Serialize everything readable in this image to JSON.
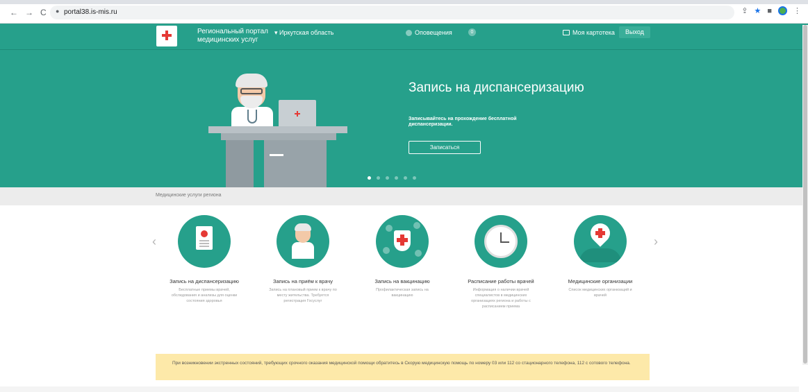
{
  "browser": {
    "nav_back": "←",
    "nav_forward": "→",
    "nav_reload": "C",
    "url": "portal38.is-mis.ru",
    "icons": [
      "share-icon",
      "star-icon",
      "extension-icon",
      "profile-icon",
      "menu-icon"
    ]
  },
  "header": {
    "site_title": "Региональный портал медицинских услуг",
    "region": "▾ Иркутская область",
    "notifications_label": "Оповещения",
    "notifications_count": "0",
    "cabinet_label": "Моя картотека",
    "logout_label": "Выход"
  },
  "hero": {
    "title": "Запись на диспансеризацию",
    "subtitle": "Записывайтесь на прохождение бесплатной диспансеризации.",
    "button_label": "Записаться",
    "slides_count": 6,
    "active_slide": 1
  },
  "breadcrumb": "Медицинские услуги региона",
  "services": [
    {
      "title": "Запись на диспансеризацию",
      "desc": "Бесплатные приемы врачей, обследования и анализы для оценки состояния здоровья",
      "icon": "clipboard-icon"
    },
    {
      "title": "Запись на приём к врачу",
      "desc": "Запись на плановый прием к врачу по месту жительства. Требуется регистрация Госуслуг",
      "icon": "doctor-icon"
    },
    {
      "title": "Запись на вакцинацию",
      "desc": "Профилактическая запись на вакцинацию",
      "icon": "vaccine-icon"
    },
    {
      "title": "Расписание работы врачей",
      "desc": "Информация о наличии врачей специалистов в медицинских организациях региона и работы с расписанием приема",
      "icon": "clock-icon"
    },
    {
      "title": "Медицинские организации",
      "desc": "Список медицинских организаций и врачей",
      "icon": "location-pin-icon"
    }
  ],
  "carousel_prev": "‹",
  "carousel_next": "›",
  "notice": "При возникновении экстренных состояний, требующих срочного оказания медицинской помощи обратитесь в Скорую медицинскую помощь по номеру 03 или 112 со стационарного телефона, 112 с сотового телефона.",
  "colors": {
    "brand": "#26a08b",
    "accent_red": "#e53935",
    "notice_bg": "#fde9a9"
  }
}
